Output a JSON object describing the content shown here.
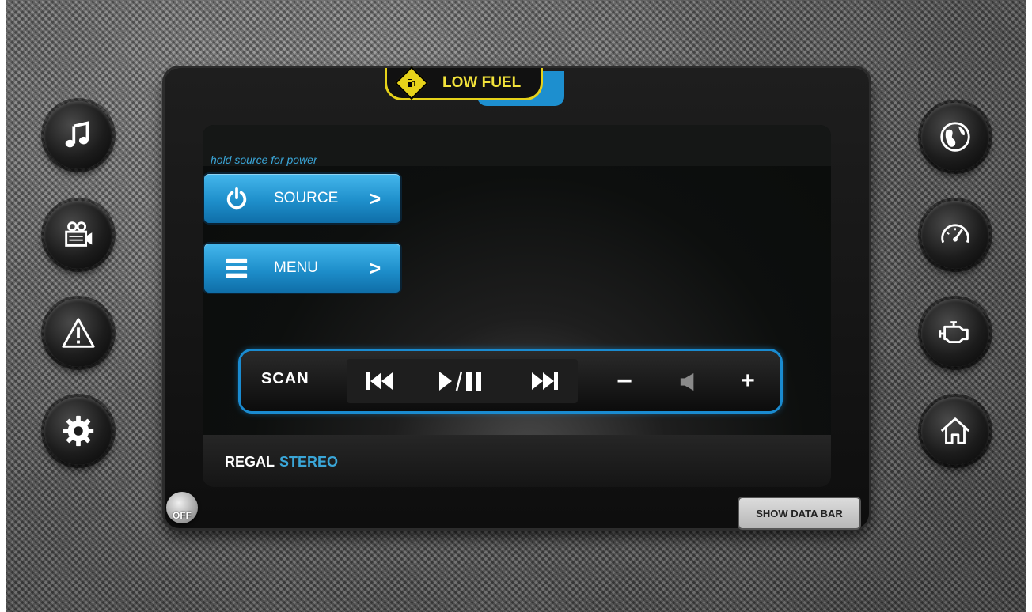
{
  "left_buttons": [
    {
      "icon": "music-note-icon"
    },
    {
      "icon": "video-camera-icon"
    },
    {
      "icon": "warning-icon"
    },
    {
      "icon": "gear-icon"
    }
  ],
  "right_buttons": [
    {
      "icon": "globe-icon"
    },
    {
      "icon": "gauge-icon"
    },
    {
      "icon": "engine-icon"
    },
    {
      "icon": "home-icon"
    }
  ],
  "alert": {
    "text": "LOW FUEL",
    "icon": "fuel-pump-icon",
    "color": "#e6d21a"
  },
  "screen": {
    "hint": "hold source for power",
    "source_button": {
      "label": "SOURCE",
      "icon": "power-icon"
    },
    "menu_button": {
      "label": "MENU",
      "icon": "menu-icon"
    },
    "transport": {
      "scan_label": "SCAN",
      "prev_icon": "skip-previous-icon",
      "play_pause_icon": "play-pause-icon",
      "next_icon": "skip-next-icon",
      "volume_down_label": "−",
      "speaker_icon": "speaker-icon",
      "volume_up_label": "+"
    },
    "brand_primary": "REGAL",
    "brand_secondary": "STEREO"
  },
  "off_label": "OFF",
  "show_data_bar_label": "SHOW DATA BAR",
  "colors": {
    "accent_blue": "#1e8fcb",
    "alert_yellow": "#e6d21a"
  }
}
